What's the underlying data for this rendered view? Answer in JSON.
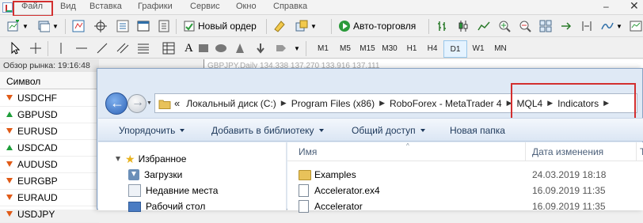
{
  "menubar": {
    "items": [
      "Файл",
      "Вид",
      "Вставка",
      "Графики",
      "Сервис",
      "Окно",
      "Справка"
    ],
    "minimize_glyph": "‒",
    "close_glyph": "✕"
  },
  "toolbar": {
    "new_order": "Новый ордер",
    "auto_trading": "Авто-торговля"
  },
  "timeframes": [
    "M1",
    "M5",
    "M15",
    "M30",
    "H1",
    "H4",
    "D1",
    "W1",
    "MN"
  ],
  "active_timeframe": "D1",
  "market_watch": {
    "header": "Обзор рынка: 19:16:48",
    "column": "Символ",
    "symbols": [
      {
        "name": "USDCHF",
        "dir": "down"
      },
      {
        "name": "GBPUSD",
        "dir": "up"
      },
      {
        "name": "EURUSD",
        "dir": "down"
      },
      {
        "name": "USDCAD",
        "dir": "up"
      },
      {
        "name": "AUDUSD",
        "dir": "down"
      },
      {
        "name": "EURGBP",
        "dir": "down"
      },
      {
        "name": "EURAUD",
        "dir": "down"
      },
      {
        "name": "USDJPY",
        "dir": "down"
      }
    ]
  },
  "chart": {
    "title": "GBPJPY,Daily  134.338 137.270 133.916 137.111"
  },
  "explorer": {
    "breadcrumbs": [
      "Локальный диск (C:)",
      "Program Files (x86)",
      "RoboForex - MetaTrader 4",
      "MQL4",
      "Indicators"
    ],
    "overflow": "«",
    "commands": {
      "organize": "Упорядочить",
      "add_library": "Добавить в библиотеку",
      "share": "Общий доступ",
      "new_folder": "Новая папка"
    },
    "nav": {
      "favorites": "Избранное",
      "downloads": "Загрузки",
      "recent": "Недавние места",
      "desktop": "Рабочий стол"
    },
    "columns": {
      "name": "Имя",
      "date": "Дата изменения",
      "type": "Т"
    },
    "files": [
      {
        "name": "Examples",
        "date": "24.03.2019 18:18",
        "kind": "folder"
      },
      {
        "name": "Accelerator.ex4",
        "date": "16.09.2019 11:35",
        "kind": "file"
      },
      {
        "name": "Accelerator",
        "date": "16.09.2019 11:35",
        "kind": "file"
      }
    ]
  },
  "colors": {
    "highlight": "#d32f2f",
    "up_arrow": "#1e9e3a",
    "down_arrow": "#e05a16"
  }
}
